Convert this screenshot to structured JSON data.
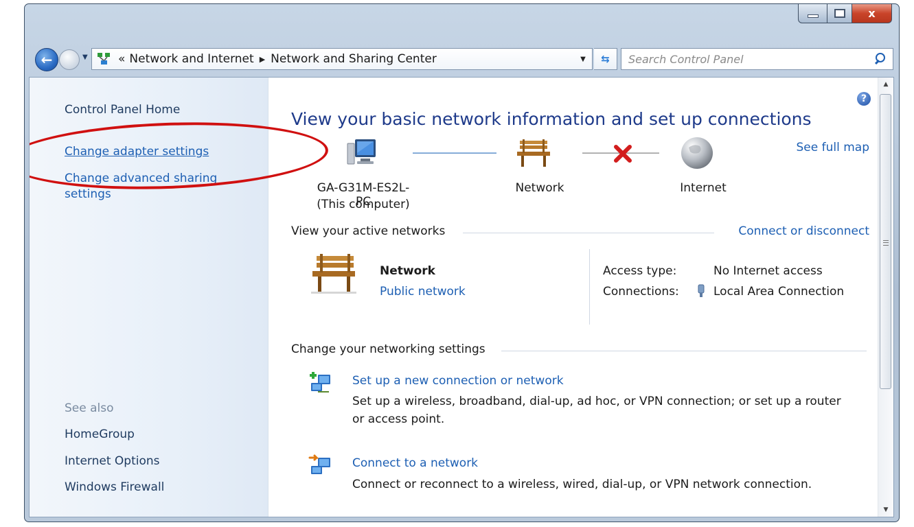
{
  "window": {
    "caption": {
      "minimize": "",
      "maximize": "",
      "close": "x"
    }
  },
  "navigation": {
    "address": {
      "prefix": "«",
      "segments": [
        "Network and Internet",
        "Network and Sharing Center"
      ]
    },
    "search": {
      "placeholder": "Search Control Panel"
    }
  },
  "sidebar": {
    "home": "Control Panel Home",
    "tasks": [
      "Change adapter settings",
      "Change advanced sharing",
      "settings"
    ],
    "see_also_title": "See also",
    "see_also": [
      "HomeGroup",
      "Internet Options",
      "Windows Firewall"
    ]
  },
  "main": {
    "heading": "View your basic network information and set up connections",
    "see_full_map": "See full map",
    "map": {
      "computer_name": "GA-G31M-ES2L-PC",
      "computer_note": "(This computer)",
      "network_label": "Network",
      "internet_label": "Internet"
    },
    "active": {
      "title": "View your active networks",
      "connect_link": "Connect or disconnect",
      "network_name": "Network",
      "network_type": "Public network",
      "access_type_label": "Access type:",
      "access_type_value": "No Internet access",
      "connections_label": "Connections:",
      "connections_value": "Local Area Connection"
    },
    "settings": {
      "title": "Change your networking settings",
      "items": [
        {
          "link": "Set up a new connection or network",
          "desc_line1": "Set up a wireless, broadband, dial-up, ad hoc, or VPN connection; or set up a router",
          "desc_line2": "or access point."
        },
        {
          "link": "Connect to a network",
          "desc_line1": "Connect or reconnect to a wireless, wired, dial-up, or VPN network connection."
        }
      ]
    }
  },
  "colors": {
    "link": "#1d5fb3",
    "heading": "#1e3a8a",
    "highlight_oval": "#d01010"
  }
}
